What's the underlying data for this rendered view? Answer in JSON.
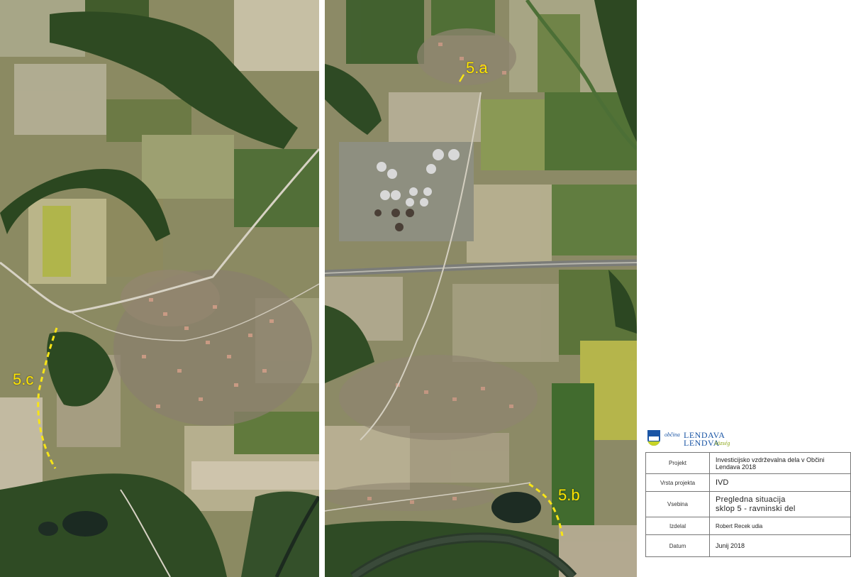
{
  "map": {
    "labels": {
      "a": "5.a",
      "b": "5.b",
      "c": "5.c"
    },
    "route_color": "#f7e417"
  },
  "title_block": {
    "logo": {
      "prefix": "občina",
      "name_sl": "LENDAVA",
      "name_hu": "LENDVA",
      "suffix": "község"
    },
    "rows": [
      {
        "key": "Projekt",
        "value": "Investicijsko vzdrževalna dela v Občini Lendava 2018"
      },
      {
        "key": "Vrsta projekta",
        "value": "IVD"
      },
      {
        "key": "Vsebina",
        "value_line1": "Pregledna   situacija",
        "value_line2": "sklop 5 - ravninski del"
      },
      {
        "key": "Izdelal",
        "value": "Robert Recek udia"
      },
      {
        "key": "Datum",
        "value": "Junij 2018"
      }
    ]
  }
}
